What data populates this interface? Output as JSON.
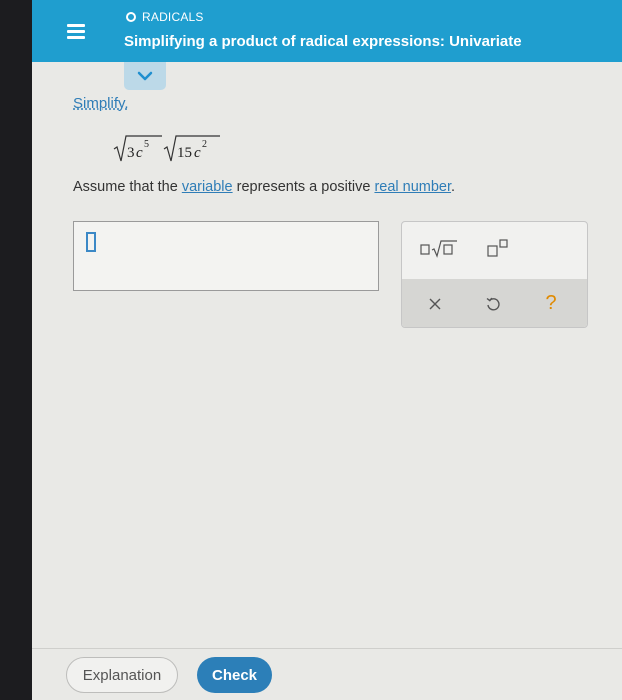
{
  "header": {
    "topic": "RADICALS",
    "title": "Simplifying a product of radical expressions: Univariate"
  },
  "prompt": {
    "simplify_label": "Simplify.",
    "expression": {
      "radicand1_coef": "3",
      "radicand1_var": "c",
      "radicand1_exp": "5",
      "radicand2_coef": "15",
      "radicand2_var": "c",
      "radicand2_exp": "2"
    },
    "assume_before": "Assume that the ",
    "assume_link1": "variable",
    "assume_middle": " represents a positive ",
    "assume_link2": "real number",
    "assume_after": "."
  },
  "palette": {
    "buttons": [
      "coefficient-radical-icon",
      "exponent-icon",
      "clear-icon",
      "undo-icon",
      "help-icon"
    ],
    "help_label": "?"
  },
  "footer": {
    "explanation_label": "Explanation",
    "check_label": "Check"
  },
  "colors": {
    "header_bg": "#1f9ecf",
    "link": "#2f7db7",
    "check_bg": "#2c7fb8",
    "help": "#e08a00"
  }
}
